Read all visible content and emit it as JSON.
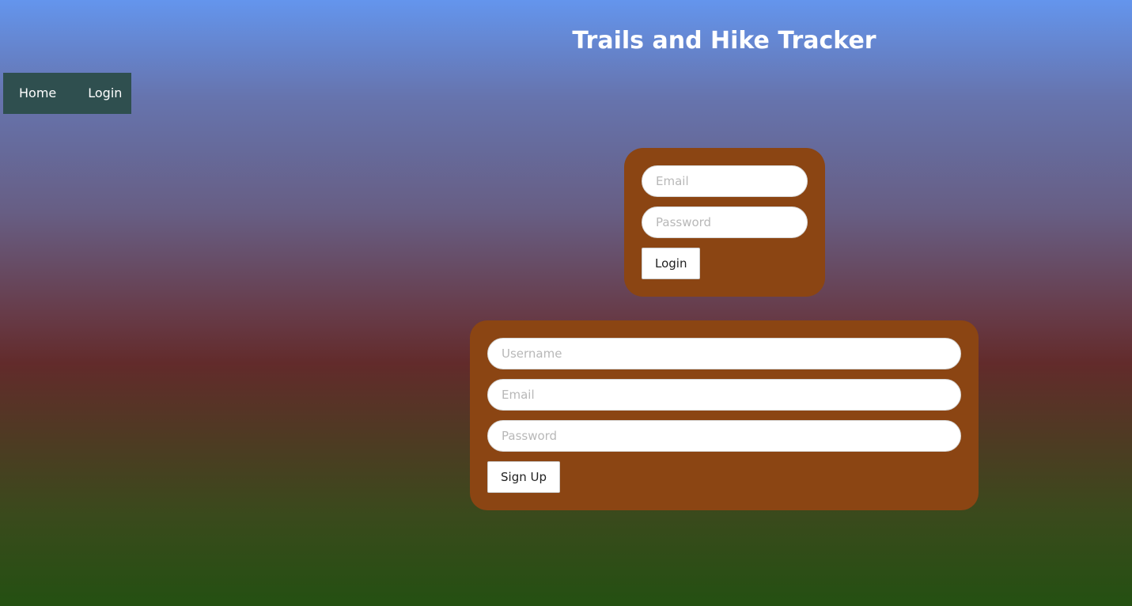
{
  "header": {
    "title": "Trails and Hike Tracker"
  },
  "nav": {
    "items": [
      {
        "label": "Home"
      },
      {
        "label": "Login"
      }
    ]
  },
  "login_form": {
    "email_placeholder": "Email",
    "password_placeholder": "Password",
    "submit_label": "Login"
  },
  "signup_form": {
    "username_placeholder": "Username",
    "email_placeholder": "Email",
    "password_placeholder": "Password",
    "submit_label": "Sign Up"
  },
  "colors": {
    "gradient_top": "#6495ED",
    "gradient_bottom": "#245012",
    "nav_background": "#2F4F4F",
    "card_background": "#8B4513"
  }
}
